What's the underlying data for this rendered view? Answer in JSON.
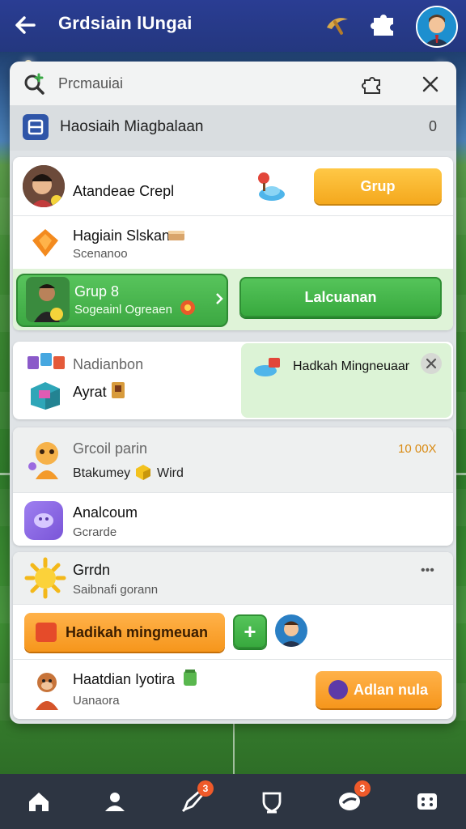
{
  "header": {
    "title": "Grdsiain lUngai",
    "icons": [
      "back-arrow-icon",
      "pickaxe-icon",
      "puzzle-icon",
      "profile-avatar"
    ]
  },
  "search": {
    "placeholder": "Prcmauiai"
  },
  "section": {
    "title": "Haosiaih Miagbalaan",
    "count": "0"
  },
  "card1": {
    "row1": {
      "name": "Atandeae Crepl",
      "button": "Grup"
    },
    "row2": {
      "name": "Hagiain Slskan",
      "sub": "Scenanoo"
    },
    "row3": {
      "name": "Grup 8",
      "sub": "Sogeainl Ogreaen",
      "button": "Lalcuanan"
    }
  },
  "card2": {
    "row1": {
      "name": "Nadianbon",
      "sub": "Ayrat",
      "popup_text": "Hadkah Mingneuaar"
    }
  },
  "card3": {
    "row1": {
      "name": "Grcoil parin",
      "sub": "Btakumey",
      "sub2": "Wird",
      "amount": "10 00X"
    },
    "row2": {
      "name": "Analcoum",
      "sub": "Gcrarde"
    }
  },
  "card4": {
    "row1": {
      "name": "Grrdn",
      "sub": "Saibnafi gorann",
      "more": "•••"
    },
    "row2": {
      "button": "Hadikah mingmeuan",
      "plus": "+"
    },
    "row3": {
      "name": "Haatdian Iyotira",
      "sub": "Uanaora",
      "button": "Adlan nula"
    }
  },
  "nav": {
    "badge1": "3",
    "badge2": "3"
  },
  "colors": {
    "topbar": "#2a3d93",
    "accent_yellow": "#f4a81d",
    "accent_green": "#38a93e",
    "accent_orange": "#f6961c",
    "nav_bg": "#2d3542"
  }
}
